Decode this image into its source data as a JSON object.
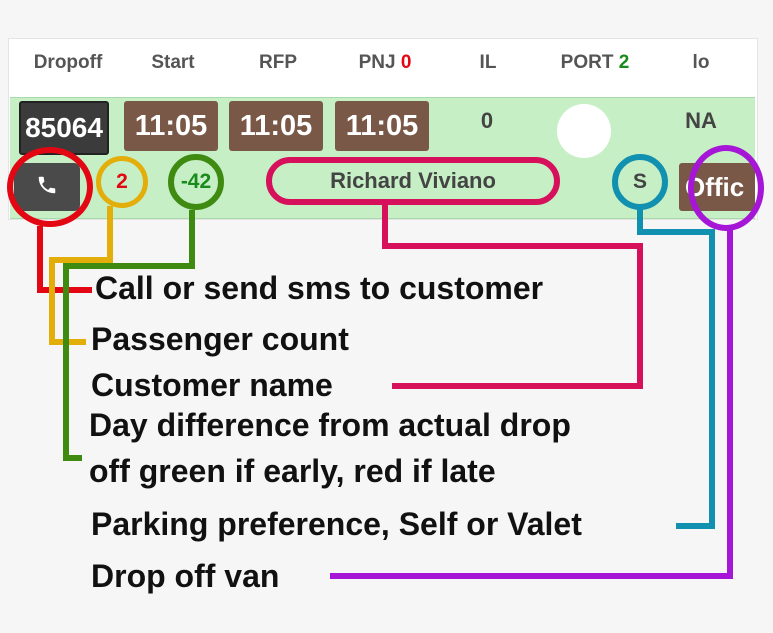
{
  "headers": {
    "dropoff": "Dropoff",
    "start": "Start",
    "rfp": "RFP",
    "pnj_label": "PNJ",
    "pnj_count": "0",
    "il": "IL",
    "port_label": "PORT",
    "port_count": "2",
    "io": "lo"
  },
  "row": {
    "dropoff_id": "85064",
    "start_time": "11:05",
    "rfp_time": "11:05",
    "pnj_time": "11:05",
    "il_value": "0",
    "io_value": "NA",
    "passenger_count": "2",
    "day_difference": "-42",
    "customer_name": "Richard Viviano",
    "parking_pref": "S",
    "van": "Offic"
  },
  "annotations": {
    "call": "Call or send sms to customer",
    "passenger": "Passenger count",
    "customer": "Customer name",
    "day_diff_1": "Day difference from actual drop",
    "day_diff_2": "off green if early, red if late",
    "parking": "Parking preference, Self or Valet",
    "van": "Drop off van"
  },
  "icons": {
    "phone": "phone-icon"
  },
  "colors": {
    "row_bg": "#c6efc6",
    "call_ring": "#e30613",
    "passenger_ring": "#e3ad0a",
    "daydiff_ring": "#3f8b12",
    "customer_ring": "#d6105a",
    "parking_ring": "#1190b0",
    "van_ring": "#a516d6",
    "late_red": "#e30613",
    "early_green": "#1a8a1a"
  }
}
